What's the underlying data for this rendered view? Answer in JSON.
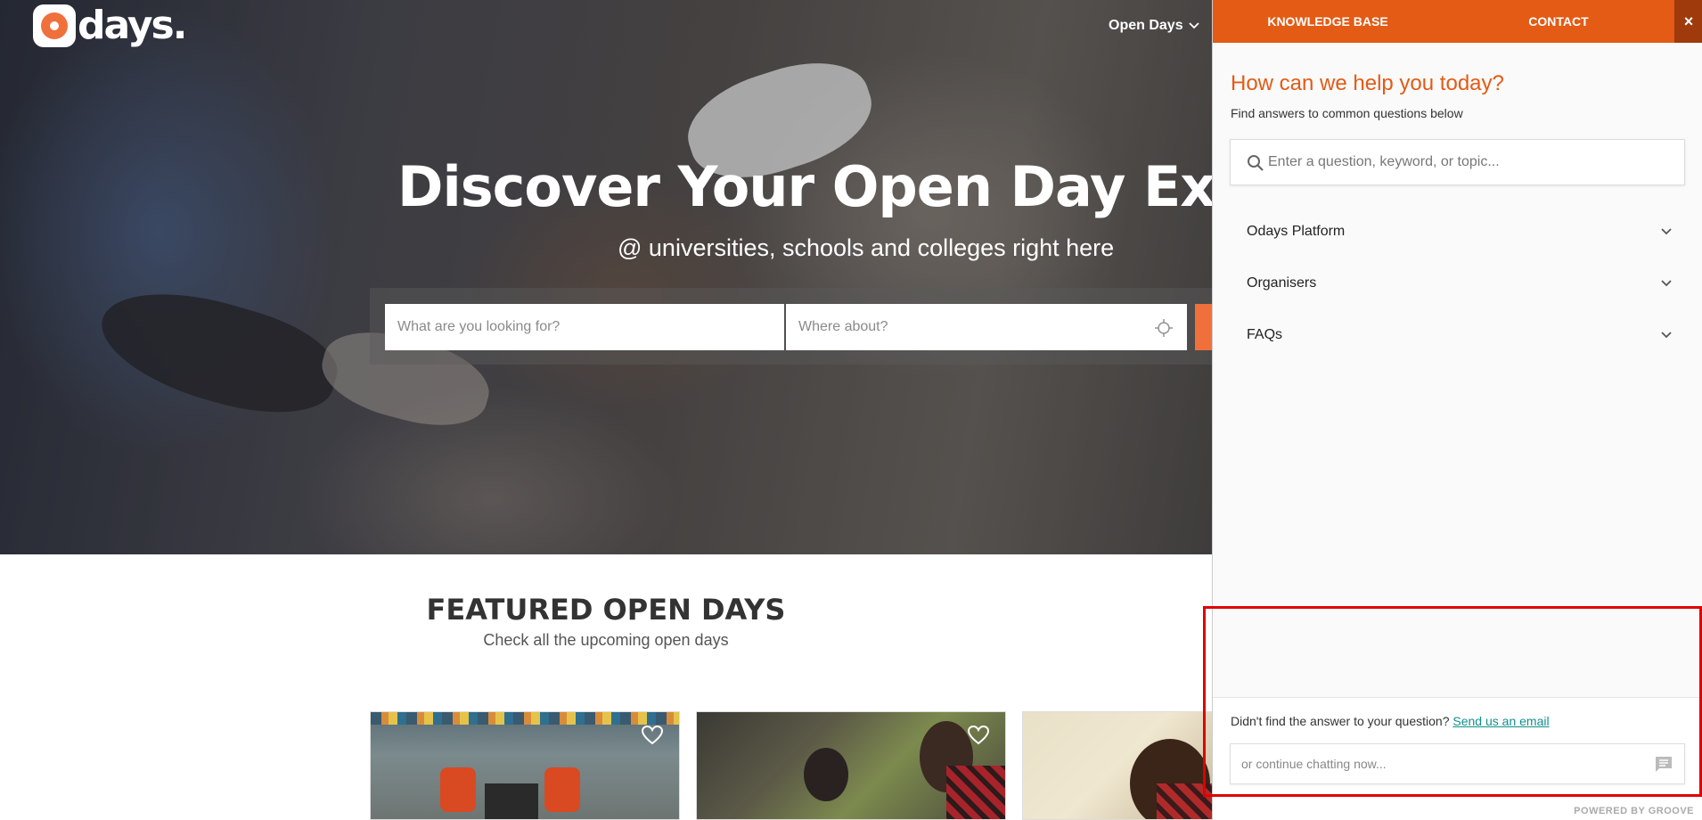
{
  "site": {
    "logo_text": "days.",
    "nav": {
      "open_days": "Open Days"
    }
  },
  "hero": {
    "title": "Discover Your Open Day Experie",
    "subtitle": "@ universities, schools and colleges right here",
    "search_what_placeholder": "What are you looking for?",
    "search_where_placeholder": "Where about?"
  },
  "featured": {
    "title": "FEATURED OPEN DAYS",
    "subtitle": "Check all the upcoming open days"
  },
  "panel": {
    "tabs": [
      "KNOWLEDGE BASE",
      "CONTACT"
    ],
    "close_label": "×",
    "heading": "How can we help you today?",
    "subheading": "Find answers to common questions below",
    "search_placeholder": "Enter a question, keyword, or topic...",
    "categories": [
      "Odays Platform",
      "Organisers",
      "FAQs"
    ],
    "footer": {
      "not_found_text": "Didn't find the answer to your question?",
      "email_link": "Send us an email",
      "chat_placeholder": "or continue chatting now...",
      "powered_by": "POWERED BY GROOVE"
    }
  },
  "colors": {
    "accent": "#e35b15",
    "accent_dark": "#9e3a0c",
    "brand_orange": "#f0703c",
    "link": "#0f8f8a",
    "highlight_box": "#e00000"
  },
  "icons": {
    "locate": "crosshair-icon",
    "favorite": "heart-outline-icon",
    "kb_search": "magnifier-icon",
    "category_toggle": "chevron-down-icon",
    "chat": "chat-bubble-icon"
  }
}
